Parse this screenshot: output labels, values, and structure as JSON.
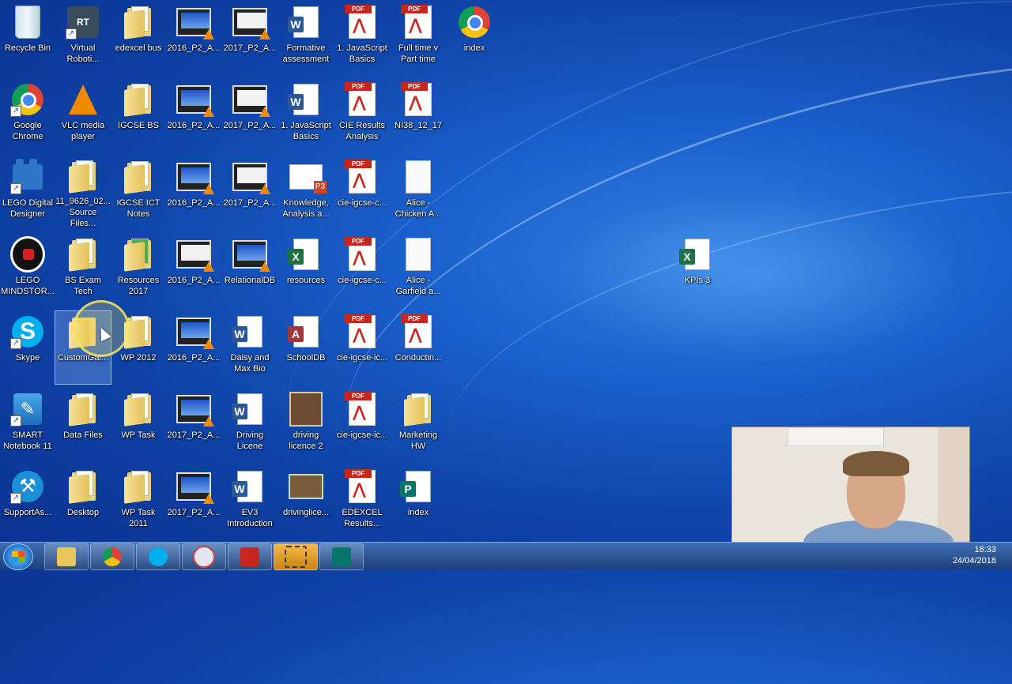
{
  "desktop": {
    "icons": [
      {
        "label": "Recycle Bin"
      },
      {
        "label": "Virtual\nRoboti..."
      },
      {
        "label": "edexcel bus"
      },
      {
        "label": "2016_P2_A..."
      },
      {
        "label": "2017_P2_A..."
      },
      {
        "label": "Formative\nassessment"
      },
      {
        "label": "1. JavaScript\nBasics"
      },
      {
        "label": "Full time v\nPart time"
      },
      {
        "label": "index"
      },
      {
        "label": "Google\nChrome"
      },
      {
        "label": "VLC media\nplayer"
      },
      {
        "label": "IGCSE BS"
      },
      {
        "label": "2016_P2_A..."
      },
      {
        "label": "2017_P2_A..."
      },
      {
        "label": "1. JavaScript\nBasics"
      },
      {
        "label": "CIE Results\nAnalysis"
      },
      {
        "label": "NI38_12_17"
      },
      {
        "label": "LEGO Digital\nDesigner"
      },
      {
        "label": "11_9626_02...\nSource Files..."
      },
      {
        "label": "IGCSE ICT\nNotes"
      },
      {
        "label": "2016_P2_A..."
      },
      {
        "label": "2017_P2_A..."
      },
      {
        "label": "Knowledge,\nAnalysis a..."
      },
      {
        "label": "cie-igcse-c..."
      },
      {
        "label": "Alice -\nChicken A..."
      },
      {
        "label": "LEGO\nMINDSTOR..."
      },
      {
        "label": "BS Exam\nTech"
      },
      {
        "label": "Resources\n2017"
      },
      {
        "label": "2016_P2_A..."
      },
      {
        "label": "RelationalDB"
      },
      {
        "label": "resources"
      },
      {
        "label": "cie-igcse-c..."
      },
      {
        "label": "Alice -\nGarfield a..."
      },
      {
        "label": "KPIs 3"
      },
      {
        "label": "Skype"
      },
      {
        "label": "CustomGal..."
      },
      {
        "label": "WP 2012"
      },
      {
        "label": "2016_P2_A..."
      },
      {
        "label": "Daisy and\nMax Bio"
      },
      {
        "label": "SchoolDB"
      },
      {
        "label": "cie-igcse-ic..."
      },
      {
        "label": "Conductin..."
      },
      {
        "label": "SMART\nNotebook 11"
      },
      {
        "label": "Data Files"
      },
      {
        "label": "WP Task"
      },
      {
        "label": "2017_P2_A..."
      },
      {
        "label": "Driving\nLicene"
      },
      {
        "label": "driving\nlicence 2"
      },
      {
        "label": "cie-igcse-ic..."
      },
      {
        "label": "Marketing\nHW"
      },
      {
        "label": "SupportAs..."
      },
      {
        "label": "Desktop"
      },
      {
        "label": "WP Task\n2011"
      },
      {
        "label": "2017_P2_A..."
      },
      {
        "label": "EV3\nIntroduction"
      },
      {
        "label": "drivinglice..."
      },
      {
        "label": "EDEXCEL\nResults..."
      },
      {
        "label": "index"
      }
    ]
  },
  "taskbar": {
    "time": "18:33",
    "date": "24/04/2018",
    "pinned": [
      "windows-explorer",
      "google-chrome",
      "skype",
      "paint",
      "adobe-reader",
      "snipping-tool",
      "publisher"
    ]
  },
  "icon_text": {
    "pdf": "PDF",
    "word": "W",
    "excel": "X",
    "access": "A",
    "publisher": "P",
    "ppt": "P3",
    "skype": "S",
    "robot": "RT"
  }
}
